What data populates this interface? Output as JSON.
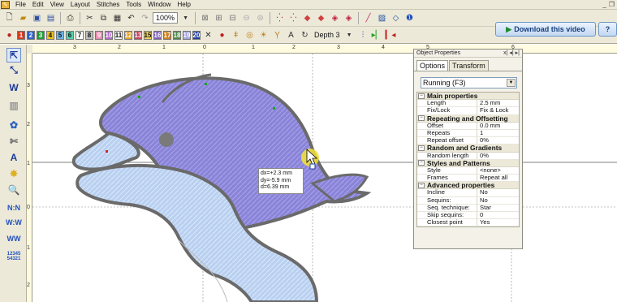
{
  "menubar": {
    "items": [
      "File",
      "Edit",
      "View",
      "Layout",
      "Stitches",
      "Tools",
      "Window",
      "Help"
    ]
  },
  "toolbar": {
    "zoom": "100%",
    "download_label": "Download this video",
    "help_label": "?"
  },
  "color_bar": {
    "swatches": [
      {
        "num": "1",
        "color": "#d43a20"
      },
      {
        "num": "2",
        "color": "#2b5fd0"
      },
      {
        "num": "3",
        "color": "#1e9e38"
      },
      {
        "num": "4",
        "color": "#e8c020"
      },
      {
        "num": "5",
        "color": "#6fb6e8"
      },
      {
        "num": "6",
        "color": "#5ad0b0"
      },
      {
        "num": "7",
        "color": "#ffffff"
      },
      {
        "num": "8",
        "color": "#c0c0c0"
      },
      {
        "num": "9",
        "color": "#e88ab0"
      },
      {
        "num": "10",
        "color": "#b06ac8"
      },
      {
        "num": "11",
        "color": "#f5f5f5"
      },
      {
        "num": "12",
        "color": "#e6a020"
      },
      {
        "num": "13",
        "color": "#cc4060"
      },
      {
        "num": "15",
        "color": "#f0d060"
      },
      {
        "num": "16",
        "color": "#8060c0"
      },
      {
        "num": "17",
        "color": "#d08020"
      },
      {
        "num": "18",
        "color": "#4a8a4a"
      },
      {
        "num": "19",
        "color": "#a0a0e0"
      },
      {
        "num": "20",
        "color": "#2040a0"
      }
    ],
    "depth_label": "Depth 3"
  },
  "hruler": {
    "ticks": [
      "3",
      "2",
      "1",
      "0",
      "1",
      "2",
      "3",
      "4",
      "5",
      "6"
    ]
  },
  "vruler": {
    "ticks": [
      "3",
      "2",
      "1",
      "0",
      "1",
      "2"
    ]
  },
  "object_properties": {
    "title": "Object Properties",
    "tabs": [
      "Options",
      "Transform"
    ],
    "stitch_type": "Running (F3)",
    "sections": [
      {
        "title": "Main properties",
        "rows": [
          {
            "k": "Length",
            "v": "2.5 mm"
          },
          {
            "k": "Fix/Lock",
            "v": "Fix & Lock"
          }
        ]
      },
      {
        "title": "Repeating and Offsetting",
        "rows": [
          {
            "k": "Offset",
            "v": "0.0 mm"
          },
          {
            "k": "Repeats",
            "v": "1"
          },
          {
            "k": "Repeat offset",
            "v": "0%"
          }
        ]
      },
      {
        "title": "Random and Gradients",
        "rows": [
          {
            "k": "Random length",
            "v": "0%"
          }
        ]
      },
      {
        "title": "Styles and Patterns",
        "rows": [
          {
            "k": "Style",
            "v": "<none>"
          },
          {
            "k": "Frames",
            "v": "Repeat all"
          }
        ]
      },
      {
        "title": "Advanced properties",
        "rows": [
          {
            "k": "Incline",
            "v": "No"
          },
          {
            "k": "Sequins:",
            "v": "No"
          },
          {
            "k": "Seq. technique:",
            "v": "Star"
          },
          {
            "k": "Skip sequins:",
            "v": "0"
          },
          {
            "k": "Closest point",
            "v": "Yes"
          }
        ]
      }
    ]
  },
  "measure": {
    "dx": "dx=+2.3 mm",
    "dy": "dy=-5.9 mm",
    "d": "d=6.39 mm"
  },
  "left_tools": {
    "text_tool": "A",
    "sample_label": "12345\n54321"
  }
}
